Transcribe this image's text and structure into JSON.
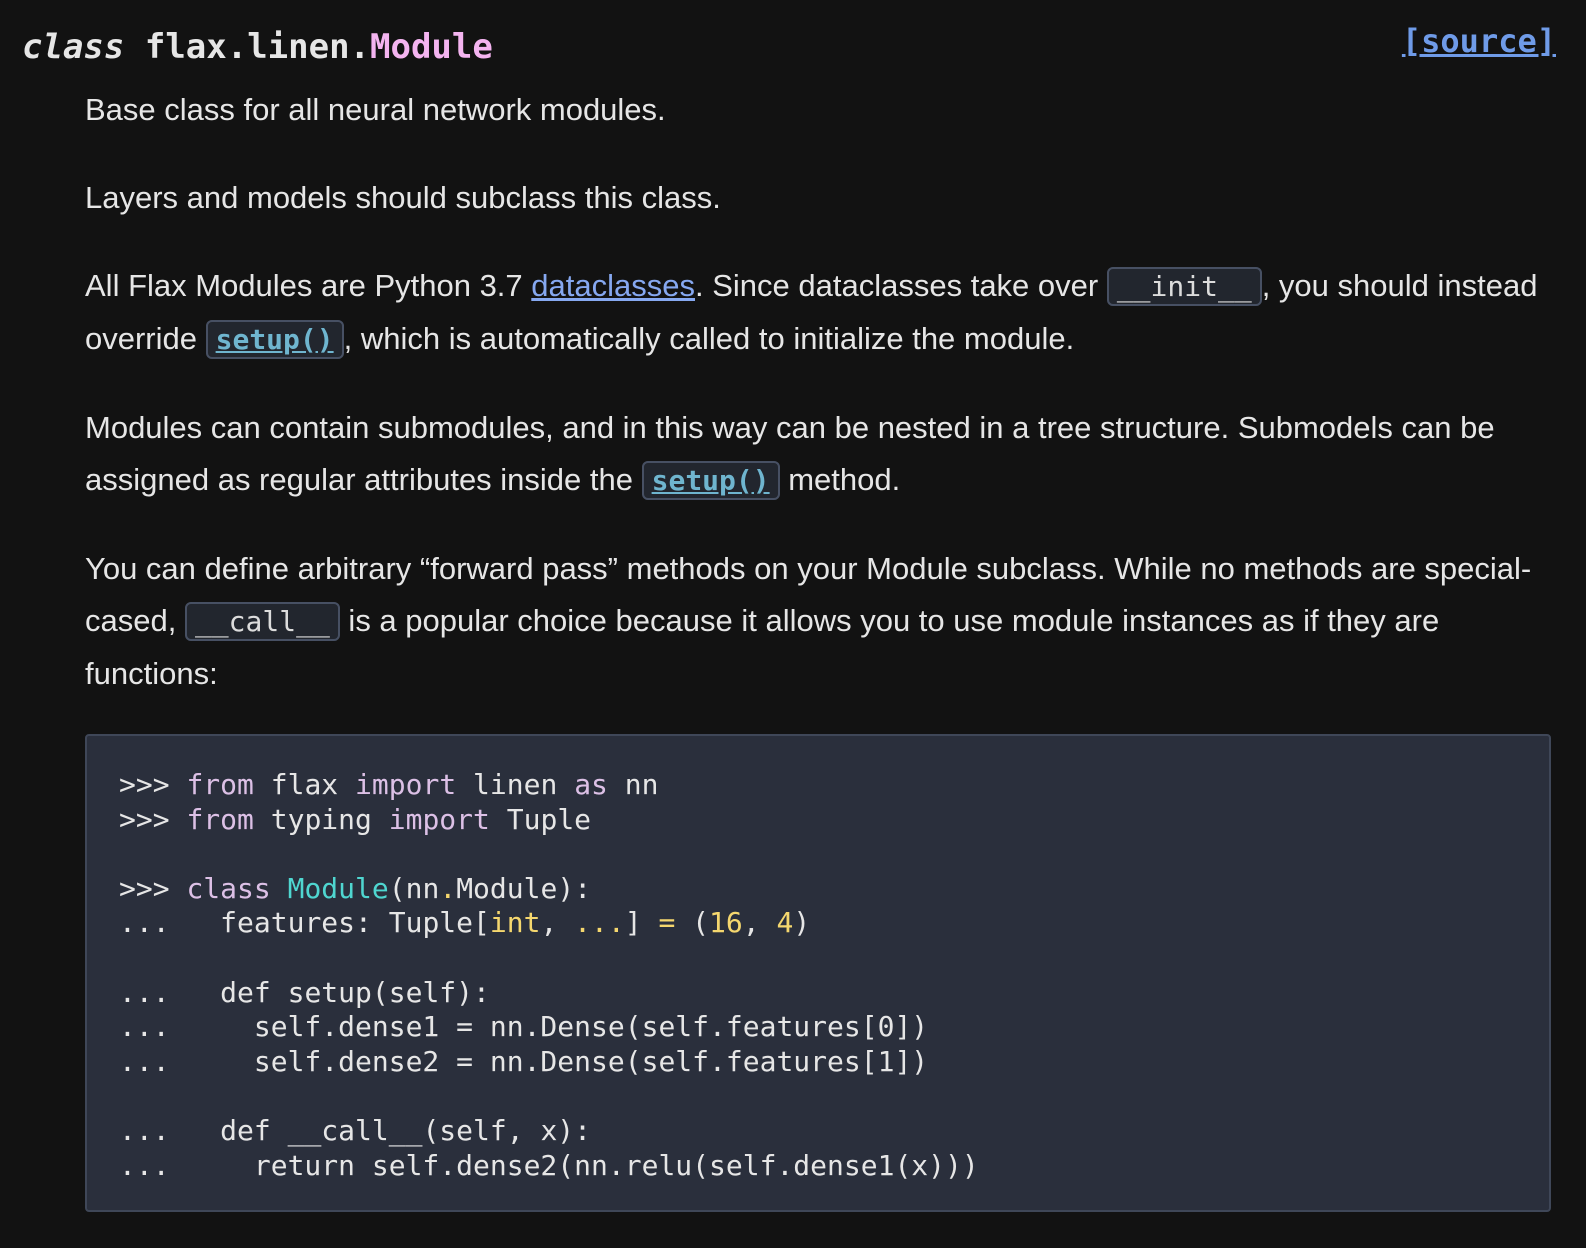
{
  "signature": {
    "keyword": "class",
    "prename": "flax.linen.",
    "name": "Module",
    "source_label": "[source]"
  },
  "doc": {
    "p1": "Base class for all neural network modules.",
    "p2": "Layers and models should subclass this class.",
    "p3": {
      "t1": "All Flax Modules are Python 3.7 ",
      "link": "dataclasses",
      "t2": ". Since dataclasses take over ",
      "code1": "__init__",
      "t3": ", you should instead override ",
      "code2": "setup()",
      "t4": ", which is automatically called to initialize the module."
    },
    "p4": {
      "t1": "Modules can contain submodules, and in this way can be nested in a tree structure. Submodels can be assigned as regular attributes inside the ",
      "code1": "setup()",
      "t2": " method."
    },
    "p5": {
      "t1": "You can define arbitrary “forward pass” methods on your Module subclass. While no methods are special-cased, ",
      "code1": "__call__",
      "t2": " is a popular choice because it allows you to use module instances as if they are functions:"
    }
  },
  "code": {
    "lines": [
      [
        [
          ">>> ",
          "gp"
        ],
        [
          "from",
          "kw"
        ],
        [
          " flax ",
          "pl"
        ],
        [
          "import",
          "kw"
        ],
        [
          " linen ",
          "pl"
        ],
        [
          "as",
          "kw"
        ],
        [
          " nn",
          "pl"
        ]
      ],
      [
        [
          ">>> ",
          "gp"
        ],
        [
          "from",
          "kw"
        ],
        [
          " typing ",
          "pl"
        ],
        [
          "import",
          "kw"
        ],
        [
          " Tuple",
          "pl"
        ]
      ],
      [],
      [
        [
          ">>> ",
          "gp"
        ],
        [
          "class",
          "kw"
        ],
        [
          " ",
          "pl"
        ],
        [
          "Module",
          "nc"
        ],
        [
          "(nn",
          "pl"
        ],
        [
          ".",
          "op"
        ],
        [
          "Module):",
          "pl"
        ]
      ],
      [
        [
          "...   ",
          "gp"
        ],
        [
          "features: Tuple[",
          "pl"
        ],
        [
          "int",
          "num"
        ],
        [
          ", ",
          "pl"
        ],
        [
          "...",
          "op"
        ],
        [
          "] ",
          "pl"
        ],
        [
          "=",
          "op"
        ],
        [
          " (",
          "pl"
        ],
        [
          "16",
          "num"
        ],
        [
          ", ",
          "pl"
        ],
        [
          "4",
          "num"
        ],
        [
          ")",
          "pl"
        ]
      ],
      [],
      [
        [
          "...   ",
          "gp"
        ],
        [
          "def setup(self):",
          "pl"
        ]
      ],
      [
        [
          "...     ",
          "gp"
        ],
        [
          "self.dense1 = nn.Dense(self.features[0])",
          "pl"
        ]
      ],
      [
        [
          "...     ",
          "gp"
        ],
        [
          "self.dense2 = nn.Dense(self.features[1])",
          "pl"
        ]
      ],
      [],
      [
        [
          "...   ",
          "gp"
        ],
        [
          "def __call__(self, x):",
          "pl"
        ]
      ],
      [
        [
          "...     ",
          "gp"
        ],
        [
          "return self.dense2(nn.relu(self.dense1(x)))",
          "pl"
        ]
      ]
    ]
  }
}
